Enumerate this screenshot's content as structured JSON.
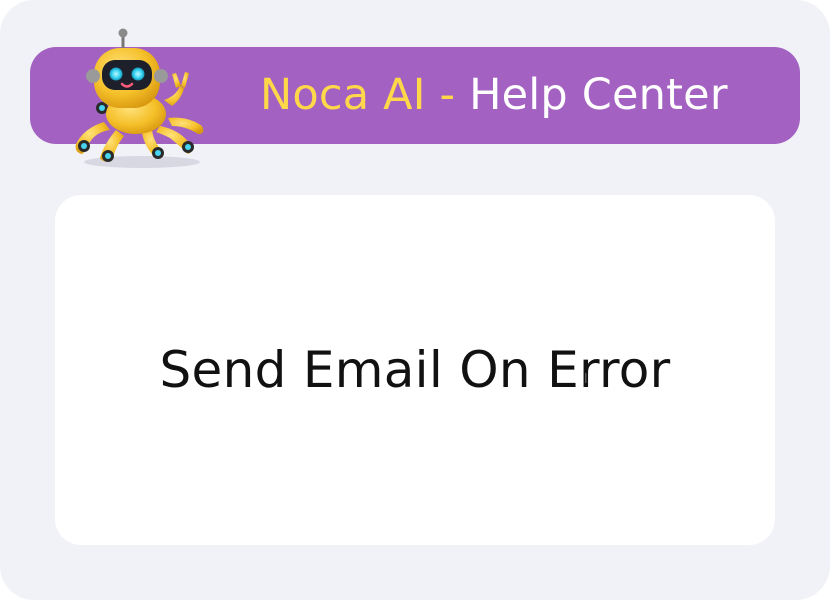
{
  "header": {
    "brand": "Noca AI",
    "separator": " - ",
    "section": "Help Center"
  },
  "article": {
    "title": "Send Email On Error"
  },
  "colors": {
    "background": "#f1f1f8",
    "banner": "#a361c1",
    "brand_text": "#ffd84a",
    "section_text": "#ffffff",
    "card": "#ffffff",
    "title_text": "#111111"
  },
  "icons": {
    "mascot": "robot-octopus-mascot-icon"
  }
}
